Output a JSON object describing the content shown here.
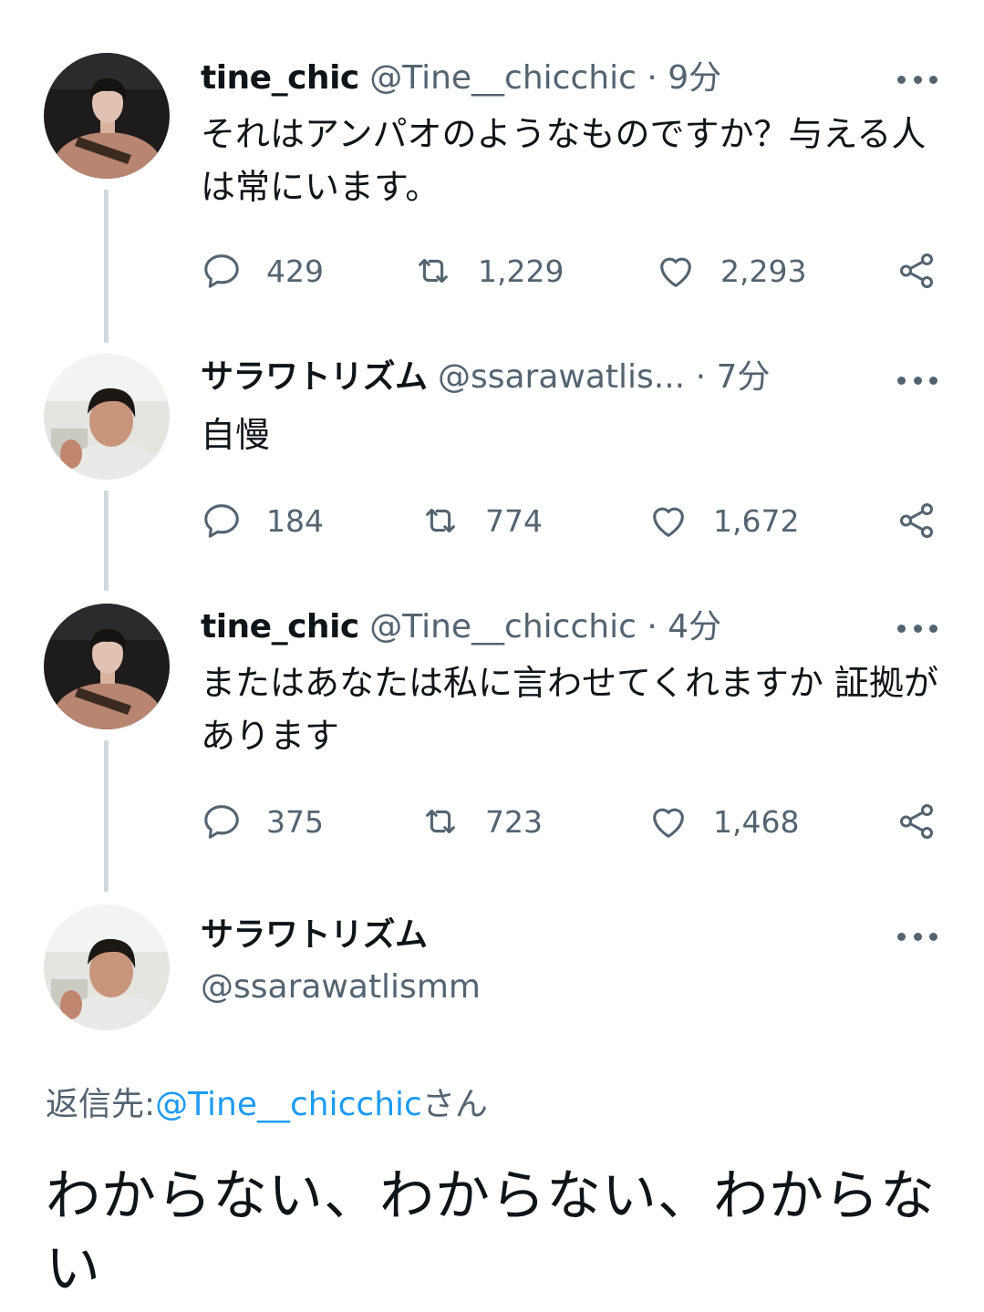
{
  "tweets": [
    {
      "name": "tine_chic",
      "handle": "@Tine__chicchic",
      "separator": "·",
      "time": "9分",
      "text": "それはアンパオのようなものですか？与える人は常にいます。",
      "reply_count": "429",
      "retweet_count": "1,229",
      "like_count": "2,293"
    },
    {
      "name": "サラワトリズム",
      "handle": "@ssarawatlis...",
      "separator": "·",
      "time": "7分",
      "text": "自慢",
      "reply_count": "184",
      "retweet_count": "774",
      "like_count": "1,672"
    },
    {
      "name": "tine_chic",
      "handle": "@Tine__chicchic",
      "separator": "·",
      "time": "4分",
      "text": "またはあなたは私に言わせてくれますか 証拠があります",
      "reply_count": "375",
      "retweet_count": "723",
      "like_count": "1,468"
    }
  ],
  "focused_tweet": {
    "name": "サラワトリズム",
    "handle": "@ssarawatlismm",
    "reply_prefix": "返信先:",
    "reply_to": "@Tine__chicchic",
    "reply_suffix": "さん",
    "text": "わからない、わからない、わからない"
  },
  "icons": {
    "reply": "reply-bubble-icon",
    "retweet": "retweet-icon",
    "like": "heart-icon",
    "share": "share-icon",
    "more": "more-dots-icon"
  },
  "colors": {
    "text": "#0f1419",
    "secondary": "#536471",
    "link": "#1d9bf0",
    "thread_line": "#cfd9de"
  }
}
